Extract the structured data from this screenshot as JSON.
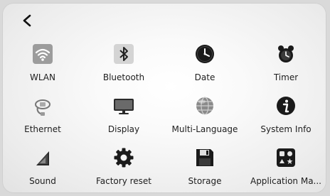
{
  "header": {
    "back_label": ""
  },
  "tiles": [
    {
      "label": "WLAN",
      "icon": "wifi-icon"
    },
    {
      "label": "Bluetooth",
      "icon": "bluetooth-icon"
    },
    {
      "label": "Date",
      "icon": "clock-icon"
    },
    {
      "label": "Timer",
      "icon": "alarm-clock-icon"
    },
    {
      "label": "Ethernet",
      "icon": "ethernet-cable-icon"
    },
    {
      "label": "Display",
      "icon": "monitor-icon"
    },
    {
      "label": "Multi-Language",
      "icon": "globe-icon"
    },
    {
      "label": "System Info",
      "icon": "info-icon"
    },
    {
      "label": "Sound",
      "icon": "speaker-icon"
    },
    {
      "label": "Factory reset",
      "icon": "gear-icon"
    },
    {
      "label": "Storage",
      "icon": "floppy-disk-icon"
    },
    {
      "label": "Application Ma...",
      "icon": "app-manager-icon"
    }
  ]
}
